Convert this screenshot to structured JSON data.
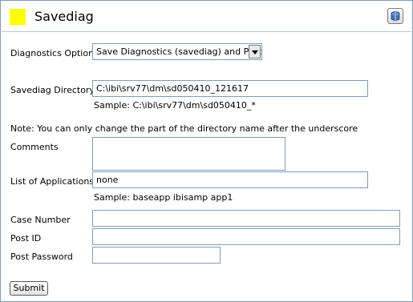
{
  "header": {
    "title": "Savediag",
    "help_icon": "help-book-icon"
  },
  "form": {
    "diagnostics_options": {
      "label": "Diagnostics Options",
      "selected": "Save Diagnostics (savediag) and Post"
    },
    "savediag_directory": {
      "label": "Savediag Directory",
      "value": "C:\\ibi\\srv77\\dm\\sd050410_121617",
      "sample": "Sample: C:\\ibi\\srv77\\dm\\sd050410_*"
    },
    "note": "Note: You can only change the part of the directory name after the underscore",
    "comments": {
      "label": "Comments",
      "value": ""
    },
    "applications": {
      "label": "List of Applications",
      "value": "none",
      "sample": "Sample: baseapp ibisamp app1"
    },
    "case_number": {
      "label": "Case Number",
      "value": ""
    },
    "post_id": {
      "label": "Post ID",
      "value": ""
    },
    "post_password": {
      "label": "Post Password",
      "value": ""
    },
    "submit_label": "Submit"
  }
}
